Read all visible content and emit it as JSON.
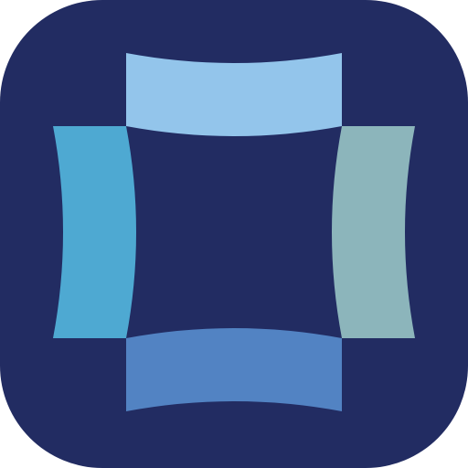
{
  "app_icon": {
    "shape": "rounded-square",
    "colors": {
      "background": "#222c62",
      "top_panel": "#93c5eb",
      "left_panel": "#4ea9d2",
      "right_panel": "#8cb5bb",
      "bottom_panel": "#5283c3"
    },
    "icon": "four-curved-panels-square-logo-icon"
  }
}
